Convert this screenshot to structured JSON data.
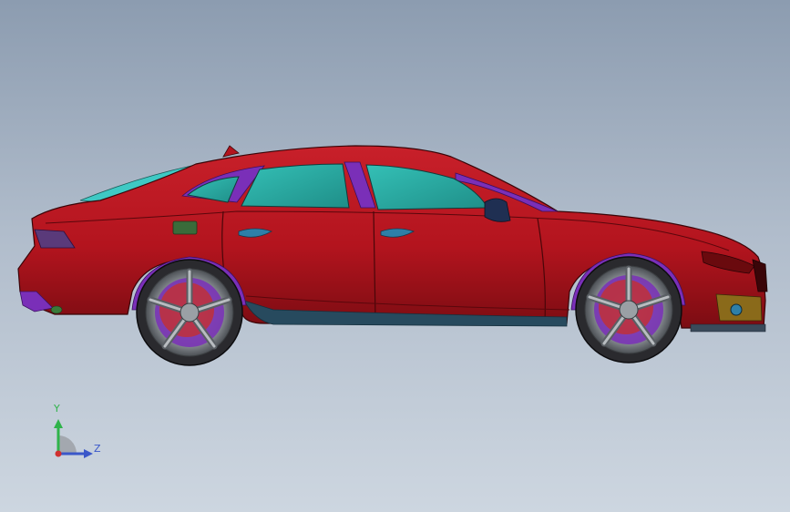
{
  "viewport": {
    "background_top": "#8c9cb0",
    "background_bottom": "#cdd6e0"
  },
  "model": {
    "body_color": "#b3141e",
    "body_shadow_color": "#800c12",
    "glass_color": "#2bb3a8",
    "upper_glass_color": "#3fc9c4",
    "trim_color": "#7a2fb8",
    "underbody_color": "#274a5e",
    "wheel_arch_color": "#7a2fb8",
    "rim_color": "#8a8f95",
    "brake_color": "#c43030",
    "handle_color": "#2e7fa8"
  },
  "triad": {
    "y_label": "Y",
    "z_label": "Z",
    "y_color": "#2fb34a",
    "z_color": "#3a57c9",
    "origin_color": "#d03030"
  }
}
